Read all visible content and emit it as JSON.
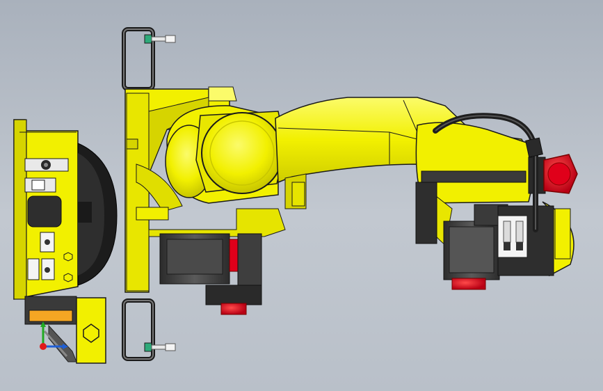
{
  "viewport": {
    "background_top": "#a9b1bc",
    "background_bottom": "#c2c8d0"
  },
  "model": {
    "colors": {
      "body_yellow": "#f2f000",
      "body_yellow_shade": "#d6d400",
      "body_yellow_light": "#fbfb6a",
      "outline": "#1a1a1a",
      "motor_dark": "#3a3a3a",
      "motor_gray": "#6e6e6e",
      "cap_red": "#e0001a",
      "cable_black": "#1e1e1e",
      "label_orange": "#f5a623",
      "bolt_green": "#2eaa7a"
    },
    "icons": [
      "axis-triad-icon",
      "hex-bolt-icon",
      "lifting-handle-icon"
    ]
  },
  "triad": {
    "x_color": "#1f5fd6",
    "y_color": "#22aa22",
    "z_color": "#e01a1a"
  }
}
